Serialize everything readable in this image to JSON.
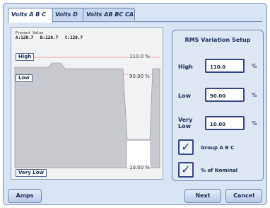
{
  "tabs": [
    {
      "label": "Volts A B C"
    },
    {
      "label": "Volts D"
    },
    {
      "label": "Volts AB BC CA"
    }
  ],
  "readout": {
    "header_line1": "Present Value",
    "header_line2": "A:120.7",
    "values": [
      "A:120.7",
      "B:120.7",
      "C:120.7"
    ]
  },
  "plot": {
    "high_tag": "High",
    "low_tag": "Low",
    "very_low_tag": "Very Low",
    "high_pct": "110.0 %",
    "low_pct": "90.00 %",
    "very_low_pct": "10.00 %"
  },
  "setup": {
    "title": "RMS Variation Setup",
    "high_label": "High",
    "low_label": "Low",
    "very_low_label_1": "Very",
    "very_low_label_2": "Low",
    "high_value": "110.0",
    "low_value": "90.00",
    "very_low_value": "10.00",
    "unit": "%",
    "group_label": "Group A B C",
    "nominal_label": "% of Nominal",
    "group_checked": true,
    "nominal_checked": true
  },
  "buttons": {
    "amps": "Amps",
    "next": "Next",
    "cancel": "Cancel"
  },
  "colors": {
    "accent": "#34468c",
    "panel": "#d9e4f4"
  }
}
